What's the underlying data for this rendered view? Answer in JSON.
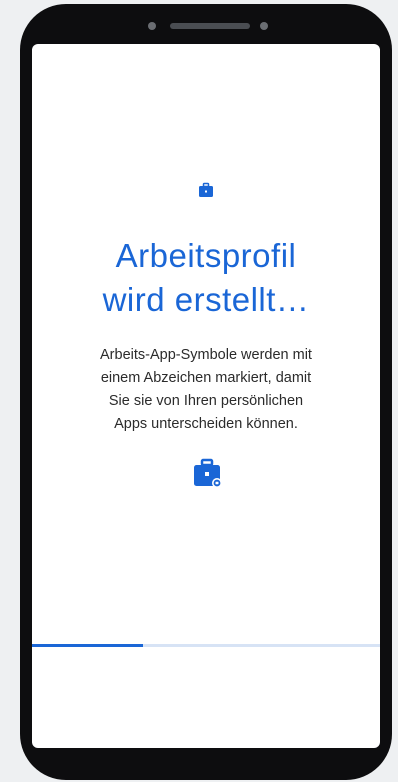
{
  "screen": {
    "title_line1": "Arbeitsprofil",
    "title_line2": "wird erstellt…",
    "description_line1": "Arbeits-App-Symbole werden mit",
    "description_line2": "einem Abzeichen markiert, damit",
    "description_line3": "Sie sie von Ihren persönlichen",
    "description_line4": "Apps unterscheiden können.",
    "top_icon": "briefcase-icon",
    "badge_icon": "work-badge-briefcase-icon",
    "progress": 0.32
  },
  "colors": {
    "accent": "#1a66d6",
    "text": "#2b2b2b",
    "phone_body": "#0d0d0f",
    "background": "#eef0f2"
  }
}
